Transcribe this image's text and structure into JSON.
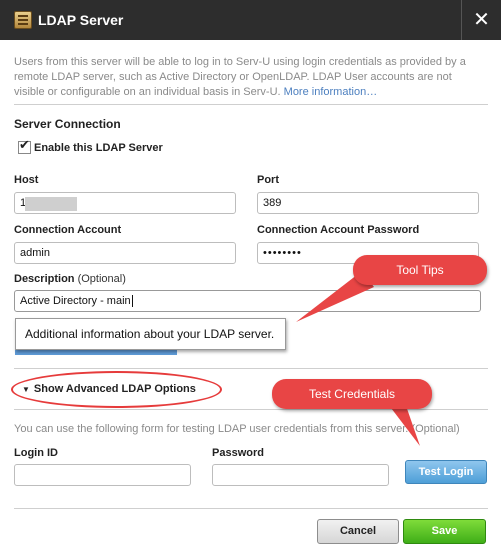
{
  "dialog": {
    "title": "LDAP Server",
    "close_glyph": "✕",
    "intro_text": "Users from this server will be able to log in to Serv-U using login credentials as provided by a remote LDAP server, such as Active Directory or OpenLDAP. LDAP User accounts are not visible or configurable on an individual basis in Serv-U.",
    "more_info_link": "More information…"
  },
  "server_connection": {
    "section_title": "Server Connection",
    "enable_label": "Enable this LDAP Server",
    "enable_checked": true,
    "host": {
      "label": "Host",
      "value": "1"
    },
    "port": {
      "label": "Port",
      "value": "389"
    },
    "account": {
      "label": "Connection Account",
      "value": "admin"
    },
    "password": {
      "label": "Connection Account Password",
      "value": "••••••••"
    },
    "description": {
      "label": "Description",
      "optional": "(Optional)",
      "value": "Active Directory - main"
    },
    "tooltip": "Additional information about your LDAP server."
  },
  "advanced": {
    "toggle_label": "Show Advanced LDAP Options",
    "toggle_icon": "triangle-down-icon"
  },
  "test": {
    "hint": "You can use the following form for testing LDAP user credentials from this server. (Optional)",
    "login_id_label": "Login ID",
    "login_id_value": "",
    "password_label": "Password",
    "password_value": "",
    "test_button": "Test Login"
  },
  "footer": {
    "cancel_label": "Cancel",
    "save_label": "Save"
  },
  "annotations": {
    "tooltips_callout": "Tool Tips",
    "test_callout": "Test Credentials"
  },
  "colors": {
    "titlebar": "#2d2d2d",
    "callout": "#e84545",
    "save": "#3fae18",
    "test": "#4e9fd8",
    "link": "#4c7fbf"
  }
}
